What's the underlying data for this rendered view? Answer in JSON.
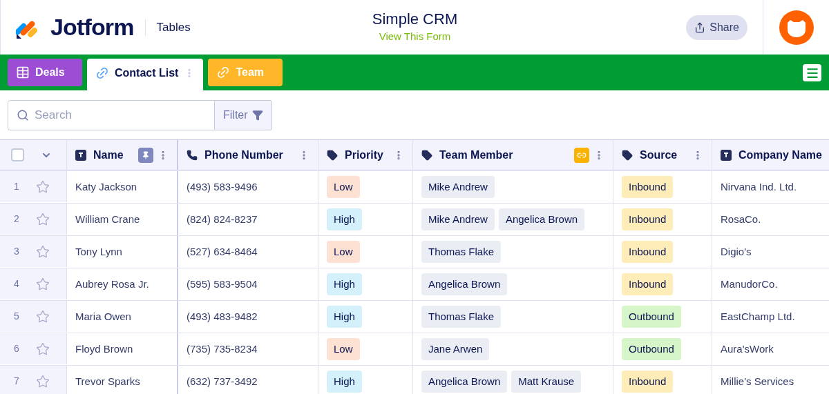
{
  "header": {
    "brand": "Jotform",
    "product": "Tables",
    "title": "Simple CRM",
    "subtitle": "View This Form",
    "share": "Share"
  },
  "tabs": [
    {
      "label": "Deals",
      "kind": "table",
      "color": "#9c4dd3",
      "selected": false
    },
    {
      "label": "Contact List",
      "kind": "link",
      "color": "#ffffff",
      "selected": true
    },
    {
      "label": "Team",
      "kind": "link",
      "color": "#ffb629",
      "selected": false
    }
  ],
  "search": {
    "placeholder": "Search",
    "filter": "Filter"
  },
  "table": {
    "select_all": {
      "checked": false
    },
    "columns": [
      {
        "label": "Name",
        "kind": "text",
        "pinned": true
      },
      {
        "label": "Phone Number",
        "kind": "phone"
      },
      {
        "label": "Priority",
        "kind": "tag"
      },
      {
        "label": "Team Member",
        "kind": "tag",
        "linked": true
      },
      {
        "label": "Source",
        "kind": "tag"
      },
      {
        "label": "Company Name",
        "kind": "text"
      }
    ],
    "rows": [
      {
        "number": "1",
        "starred": false,
        "name": "Katy Jackson",
        "phone": "(493) 583-9496",
        "priority": {
          "label": "Low",
          "color": "#fde1d3"
        },
        "team": [
          "Mike Andrew"
        ],
        "source": {
          "label": "Inbound",
          "color": "#feecb9"
        },
        "company": "Nirvana Ind. Ltd."
      },
      {
        "number": "2",
        "starred": false,
        "name": "William Crane",
        "phone": "(824) 824-8237",
        "priority": {
          "label": "High",
          "color": "#d3f0fb"
        },
        "team": [
          "Mike Andrew",
          "Angelica Brown"
        ],
        "source": {
          "label": "Inbound",
          "color": "#feecb9"
        },
        "company": "RosaCo."
      },
      {
        "number": "3",
        "starred": false,
        "name": "Tony Lynn",
        "phone": "(527) 634-8464",
        "priority": {
          "label": "Low",
          "color": "#fde1d3"
        },
        "team": [
          "Thomas Flake"
        ],
        "source": {
          "label": "Inbound",
          "color": "#feecb9"
        },
        "company": "Digio's"
      },
      {
        "number": "4",
        "starred": false,
        "name": "Aubrey Rosa Jr.",
        "phone": "(595) 583-9504",
        "priority": {
          "label": "High",
          "color": "#d3f0fb"
        },
        "team": [
          "Angelica Brown"
        ],
        "source": {
          "label": "Inbound",
          "color": "#feecb9"
        },
        "company": "ManudorCo."
      },
      {
        "number": "5",
        "starred": false,
        "name": "Maria Owen",
        "phone": "(493) 483-9482",
        "priority": {
          "label": "High",
          "color": "#d3f0fb"
        },
        "team": [
          "Thomas Flake"
        ],
        "source": {
          "label": "Outbound",
          "color": "#d6f5c9"
        },
        "company": "EastChamp Ltd."
      },
      {
        "number": "6",
        "starred": false,
        "name": "Floyd Brown",
        "phone": "(735) 735-8234",
        "priority": {
          "label": "Low",
          "color": "#fde1d3"
        },
        "team": [
          "Jane Arwen"
        ],
        "source": {
          "label": "Outbound",
          "color": "#d6f5c9"
        },
        "company": "Aura'sWork"
      },
      {
        "number": "7",
        "starred": false,
        "name": "Trevor Sparks",
        "phone": "(632) 737-3492",
        "priority": {
          "label": "High",
          "color": "#d3f0fb"
        },
        "team": [
          "Angelica Brown",
          "Matt Krause"
        ],
        "source": {
          "label": "Inbound",
          "color": "#feecb9"
        },
        "company": "Millie's Services"
      }
    ]
  }
}
